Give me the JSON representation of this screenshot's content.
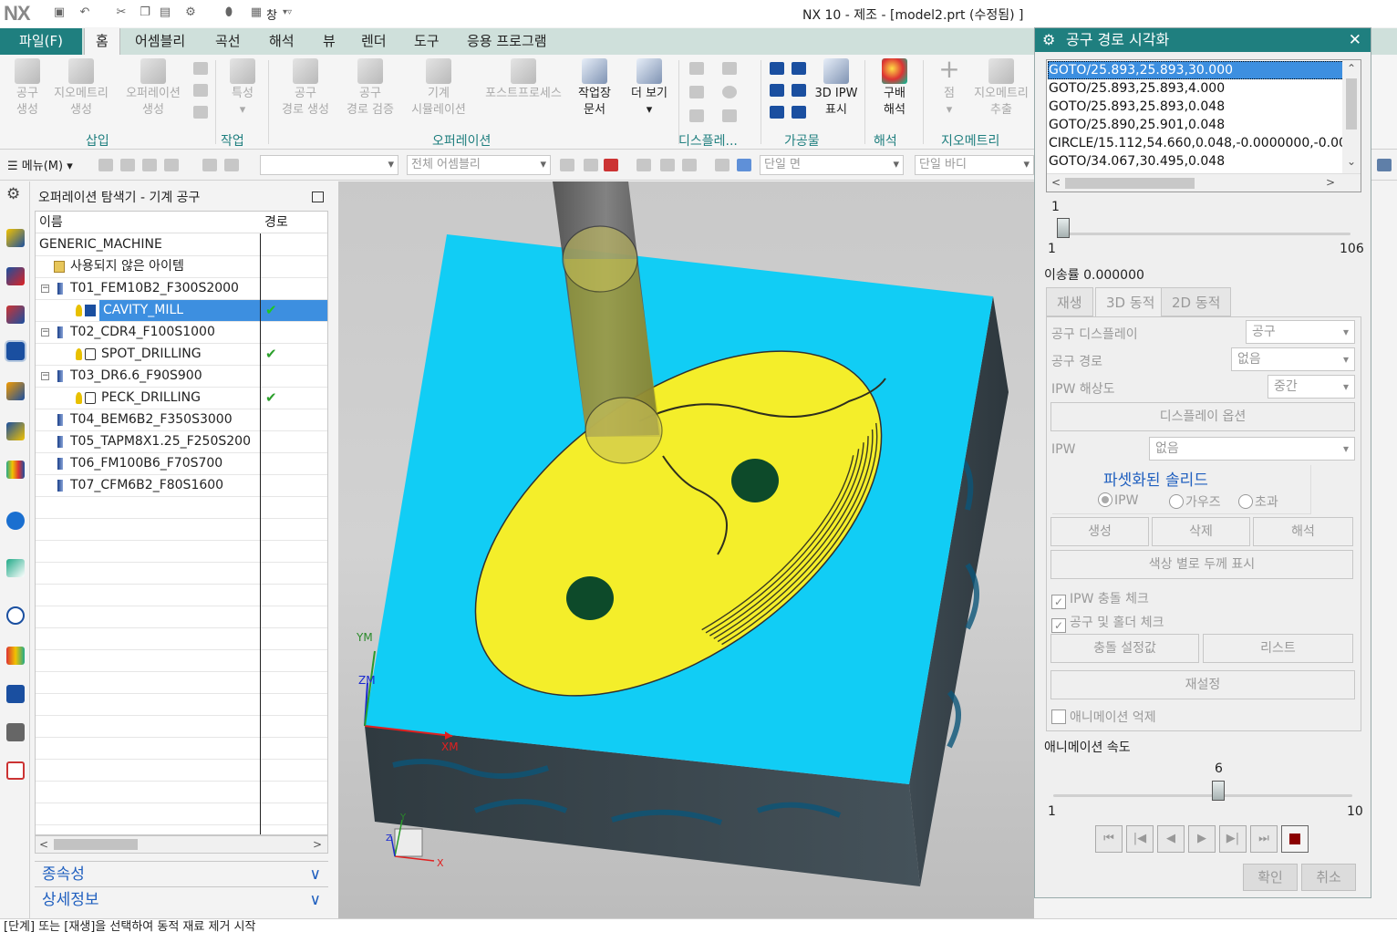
{
  "app": {
    "logo": "NX",
    "window_title": "NX 10 - 제조 - [model2.prt (수정됨) ]",
    "quick_access": {
      "window_menu_label": "창"
    }
  },
  "ribbon": {
    "tabs": [
      "파일(F)",
      "홈",
      "어셈블리",
      "곡선",
      "해석",
      "뷰",
      "렌더",
      "도구",
      "응용 프로그램"
    ],
    "buttons": [
      {
        "label1": "공구",
        "label2": "생성"
      },
      {
        "label1": "지오메트리",
        "label2": "생성"
      },
      {
        "label1": "오퍼레이션",
        "label2": "생성"
      },
      {
        "label1": "특성",
        "label2": ""
      },
      {
        "label1": "공구",
        "label2": "경로 생성"
      },
      {
        "label1": "공구",
        "label2": "경로 검증"
      },
      {
        "label1": "기계",
        "label2": "시뮬레이션"
      },
      {
        "label1": "포스트프로세스",
        "label2": ""
      },
      {
        "label1": "작업장",
        "label2": "문서"
      },
      {
        "label1": "더 보기",
        "label2": ""
      },
      {
        "label1": "3D IPW",
        "label2": "표시"
      },
      {
        "label1": "구배",
        "label2": "해석"
      },
      {
        "label1": "점",
        "label2": ""
      },
      {
        "label1": "지오메트리",
        "label2": "추출"
      }
    ],
    "groups": [
      "삽입",
      "작업",
      "오퍼레이션",
      "디스플레...",
      "가공물",
      "해석",
      "지오메트리"
    ]
  },
  "toolbar": {
    "menu_label": "메뉴(M)",
    "assembly_filter": "전체 어셈블리",
    "face_rule": "단일 면",
    "body_rule": "단일 바디"
  },
  "navigator": {
    "title": "오퍼레이션 탐색기 - 기계 공구",
    "columns": [
      "이름",
      "경로"
    ],
    "rows": [
      {
        "name": "GENERIC_MACHINE",
        "path": ""
      },
      {
        "name": "사용되지 않은 아이템",
        "path": ""
      },
      {
        "name": "T01_FEM10B2_F300S2000",
        "path": ""
      },
      {
        "name": "CAVITY_MILL",
        "path": "✔"
      },
      {
        "name": "T02_CDR4_F100S1000",
        "path": ""
      },
      {
        "name": "SPOT_DRILLING",
        "path": "✔"
      },
      {
        "name": "T03_DR6.6_F90S900",
        "path": ""
      },
      {
        "name": "PECK_DRILLING",
        "path": "✔"
      },
      {
        "name": "T04_BEM6B2_F350S3000",
        "path": ""
      },
      {
        "name": "T05_TAPM8X1.25_F250S200",
        "path": ""
      },
      {
        "name": "T06_FM100B6_F70S700",
        "path": ""
      },
      {
        "name": "T07_CFM6B2_F80S1600",
        "path": ""
      }
    ],
    "sections": [
      "종속성",
      "상세정보"
    ]
  },
  "viewport": {
    "axis_labels": {
      "ym": "YM",
      "zm": "ZM",
      "xm": "XM",
      "y": "Y",
      "z": "Z",
      "x": "X"
    },
    "colors": {
      "top_face": "#11cdf5",
      "side_face": "#3d4a50",
      "pocket": "#f4ee2a",
      "hole": "#0d4a2a"
    }
  },
  "status": {
    "text": "[단계] 또는 [재생]을 선택하여 동적 재료 제거 시작"
  },
  "dialog": {
    "title": "공구 경로 시각화",
    "commands": [
      "GOTO/25.893,25.893,30.000",
      "GOTO/25.893,25.893,4.000",
      "GOTO/25.893,25.893,0.048",
      "GOTO/25.890,25.901,0.048",
      "CIRCLE/15.112,54.660,0.048,-0.0000000,-0.0000000",
      "GOTO/34.067,30.495,0.048"
    ],
    "step_slider": {
      "value": "1",
      "min": "1",
      "max": "106",
      "fraction": 0.0
    },
    "feed_label": "이송률 0.000000",
    "tabs": [
      "재생",
      "3D 동적",
      "2D 동적"
    ],
    "tool_display_label": "공구 디스플레이",
    "tool_display_value": "공구",
    "tool_path_label": "공구 경로",
    "tool_path_value": "없음",
    "ipw_resolution_label": "IPW 해상도",
    "ipw_resolution_value": "중간",
    "display_options_button": "디스플레이 옵션",
    "ipw_label": "IPW",
    "ipw_value": "없음",
    "facet_label": "파셋화된 솔리드",
    "radios": [
      "IPW",
      "가우즈",
      "초과"
    ],
    "buttons_row": [
      "생성",
      "삭제",
      "해석"
    ],
    "thickness_button": "색상 별로 두께 표시",
    "check_ipw": "IPW 충돌 체크",
    "check_holder": "공구 및 홀더 체크",
    "collision_settings": "충돌 설정값",
    "list_button": "리스트",
    "reset_button": "재설정",
    "suppress_animation": "애니메이션 억제",
    "speed_label": "애니메이션 속도",
    "speed_slider": {
      "value": "6",
      "min": "1",
      "max": "10",
      "fraction": 0.5556
    },
    "ok": "확인",
    "cancel": "취소"
  }
}
